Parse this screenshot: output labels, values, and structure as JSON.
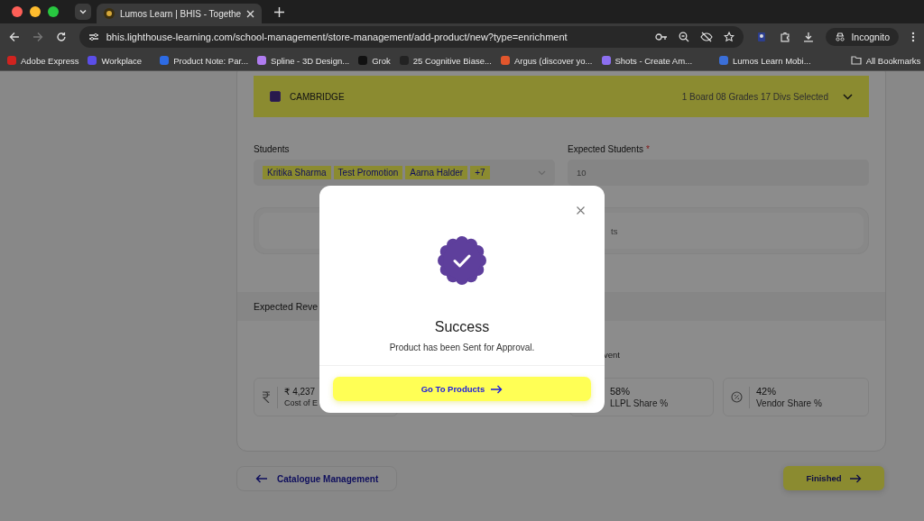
{
  "browser": {
    "tabs": [
      {
        "title": "Lumos Learn | BHIS - Togethe",
        "selected": true
      }
    ],
    "url": "bhis.lighthouse-learning.com/school-management/store-management/add-product/new?type=enrichment",
    "profile": "Incognito",
    "bookmarks": [
      {
        "kind": "site",
        "label": "Adobe Express",
        "color": "#d0231f"
      },
      {
        "kind": "site",
        "label": "Workplace",
        "color": "#5b4ee8"
      },
      {
        "kind": "globe"
      },
      {
        "kind": "site",
        "label": "Product Note: Par...",
        "color": "#2d6be4"
      },
      {
        "kind": "site",
        "label": "Spline - 3D Design...",
        "color": "#b07cf0"
      },
      {
        "kind": "site",
        "label": "Grok",
        "color": "#111111"
      },
      {
        "kind": "site",
        "label": "25 Cognitive Biase...",
        "color": "#222222"
      },
      {
        "kind": "site",
        "label": "Argus (discover yo...",
        "color": "#e2562c"
      },
      {
        "kind": "site",
        "label": "Shots - Create Am...",
        "color": "#8c6ff0"
      },
      {
        "kind": "globe"
      },
      {
        "kind": "globe"
      },
      {
        "kind": "site",
        "label": "Lumos Learn Mobi...",
        "color": "#3b6fd8"
      }
    ],
    "all_bookmarks": "All Bookmarks"
  },
  "page": {
    "board": {
      "name": "CAMBRIDGE",
      "checked": true,
      "summary": "1 Board 08 Grades 17 Divs Selected"
    },
    "students": {
      "label": "Students",
      "tags": [
        "Kritika Sharma",
        "Test Promotion",
        "Aarna Halder",
        "+7"
      ]
    },
    "expected_students": {
      "label": "Expected Students",
      "required": true,
      "required_mark": "*",
      "value": "10"
    },
    "hidden_box_text": "ts",
    "revenue_heading": "Expected Reve",
    "revenue_note": "vent",
    "stats": [
      {
        "kind": "rupee",
        "value": "₹ 4,237",
        "label": "Cost of E"
      },
      {
        "kind": "plain",
        "value": "58%",
        "label": "LLPL Share %"
      },
      {
        "kind": "percent",
        "value": "42%",
        "label": "Vendor Share %"
      }
    ],
    "back_button": "Catalogue Management",
    "finish_button": "Finished"
  },
  "modal": {
    "title": "Success",
    "message": "Product has been Sent for Approval.",
    "button": "Go To Products"
  }
}
